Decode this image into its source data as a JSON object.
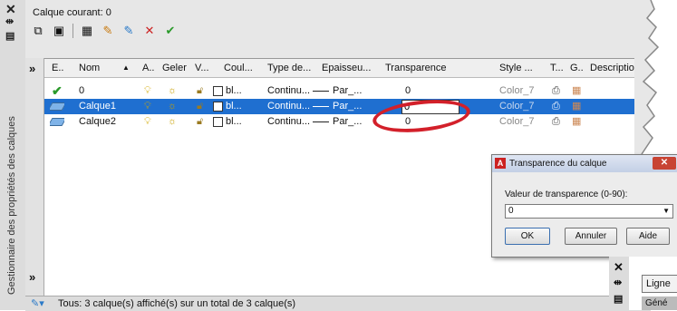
{
  "palette": {
    "vertical_title": "Gestionnaire des propriétés des calques",
    "current_layer": "Calque courant: 0",
    "toolbar_icons": [
      "new-property-filter-icon",
      "new-group-filter-icon",
      "layer-states-manager-icon",
      "new-layer-icon",
      "new-layer-vp-frozen-icon",
      "delete-layer-icon",
      "set-current-icon"
    ]
  },
  "columns": [
    "E..",
    "Nom",
    "A..",
    "Geler",
    "V...",
    "Coul...",
    "Type de...",
    "Epaisseu...",
    "Transparence",
    "Style ...",
    "T...",
    "G..",
    "Description"
  ],
  "rows": [
    {
      "status": "✔",
      "name": "0",
      "color": "bl...",
      "linetype": "Continu...",
      "lineweight": "Par_...",
      "transparency": "0",
      "plotstyle": "Color_7",
      "selected": false,
      "current": true
    },
    {
      "status": "",
      "name": "Calque1",
      "color": "bl...",
      "linetype": "Continu...",
      "lineweight": "Par_...",
      "transparency": "0",
      "plotstyle": "Color_7",
      "selected": true,
      "current": false
    },
    {
      "status": "",
      "name": "Calque2",
      "color": "bl...",
      "linetype": "Continu...",
      "lineweight": "Par_...",
      "transparency": "0",
      "plotstyle": "Color_7",
      "selected": false,
      "current": false
    }
  ],
  "status_bar": "Tous: 3 calque(s) affiché(s) sur un total de 3 calque(s)",
  "dialog": {
    "title": "Transparence du calque",
    "label": "Valeur de transparence (0-90):",
    "value": "0",
    "ok": "OK",
    "cancel": "Annuler",
    "help": "Aide"
  },
  "second_palette": {
    "tab1": "Ligne",
    "tab2": "Géné"
  },
  "colors": {
    "selection": "#1f6fd0",
    "highlight_circle": "#d3202a"
  }
}
